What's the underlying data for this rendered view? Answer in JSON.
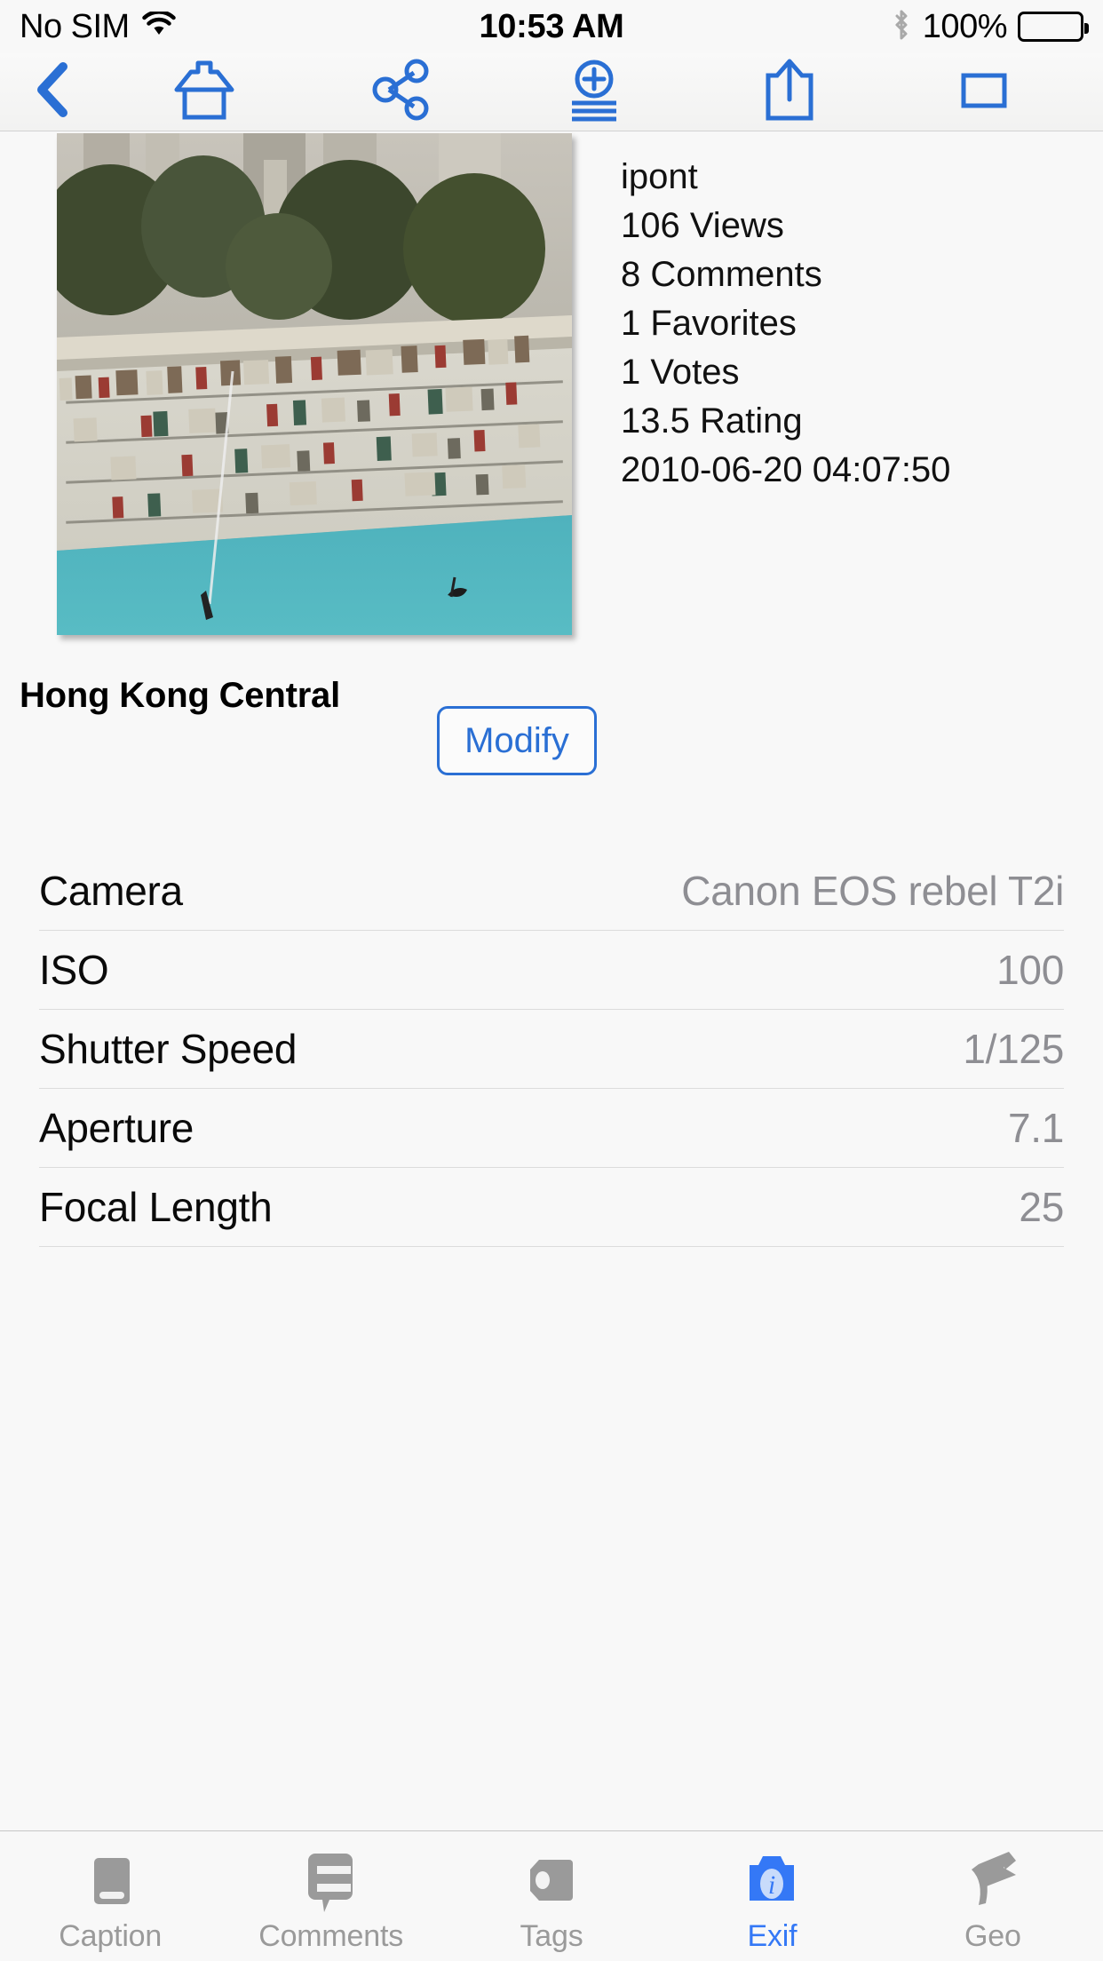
{
  "status_bar": {
    "carrier": "No SIM",
    "wifi_icon": "wifi-icon",
    "time": "10:53 AM",
    "bluetooth_icon": "bluetooth-icon",
    "battery_percent": "100%",
    "battery_icon": "battery-full-icon"
  },
  "navbar": {
    "back_icon": "chevron-left-icon",
    "tools": [
      {
        "name": "home-icon",
        "label": "Home"
      },
      {
        "name": "share-network-icon",
        "label": "Share"
      },
      {
        "name": "add-to-album-icon",
        "label": "Add to album"
      },
      {
        "name": "export-icon",
        "label": "Export"
      },
      {
        "name": "rectangle-icon",
        "label": "Slideshow"
      }
    ]
  },
  "photo": {
    "thumbnail_alt": "Hong Kong Central waterfront photo",
    "owner": "ipont",
    "views": "106 Views",
    "comments": "8 Comments",
    "favorites": "1 Favorites",
    "votes": "1 Votes",
    "rating": "13.5 Rating",
    "date_taken": "2010-06-20 04:07:50",
    "title": "Hong Kong Central",
    "modify_label": "Modify"
  },
  "exif": {
    "rows": [
      {
        "label": "Camera",
        "value": "Canon EOS rebel T2i"
      },
      {
        "label": "ISO",
        "value": "100"
      },
      {
        "label": "Shutter Speed",
        "value": "1/125"
      },
      {
        "label": "Aperture",
        "value": "7.1"
      },
      {
        "label": "Focal Length",
        "value": "25"
      }
    ]
  },
  "tabbar": {
    "active_index": 3,
    "items": [
      {
        "label": "Caption",
        "icon": "caption-icon"
      },
      {
        "label": "Comments",
        "icon": "comments-icon"
      },
      {
        "label": "Tags",
        "icon": "tag-icon"
      },
      {
        "label": "Exif",
        "icon": "exif-info-icon"
      },
      {
        "label": "Geo",
        "icon": "geo-pin-icon"
      }
    ]
  },
  "colors": {
    "accent": "#2a6fd4",
    "tab_active": "#3478f6",
    "value_gray": "#8e8e93",
    "background": "#f8f8f8"
  }
}
